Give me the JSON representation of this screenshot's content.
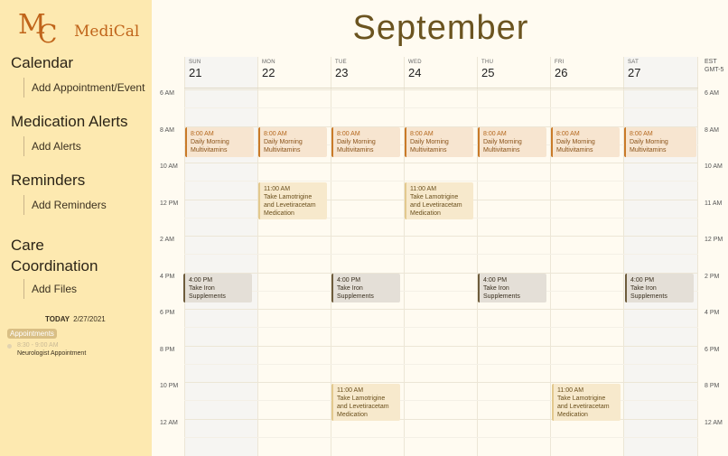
{
  "app": {
    "logo_m": "M",
    "logo_c": "C",
    "logo_text": "MediCal"
  },
  "sidebar": {
    "sections": [
      {
        "heading": "Calendar",
        "link": "Add Appointment/Event"
      },
      {
        "heading": "Medication Alerts",
        "link": "Add Alerts"
      },
      {
        "heading": "Reminders",
        "link": "Add Reminders"
      },
      {
        "heading": "Care Coordination",
        "link": "Add Files"
      }
    ],
    "today_label": "TODAY",
    "today_date": "2/27/2021",
    "appointments_chip": "Appointments",
    "appointment": {
      "time": "8:30 - 9:00 AM",
      "title": "Neurologist Appointment"
    }
  },
  "calendar": {
    "month": "September",
    "days": [
      {
        "dow": "SUN",
        "num": "21"
      },
      {
        "dow": "MON",
        "num": "22"
      },
      {
        "dow": "TUE",
        "num": "23"
      },
      {
        "dow": "WED",
        "num": "24"
      },
      {
        "dow": "THU",
        "num": "25"
      },
      {
        "dow": "FRI",
        "num": "26"
      },
      {
        "dow": "SAT",
        "num": "27"
      }
    ],
    "left_times": [
      "6 AM",
      "8 AM",
      "10 AM",
      "12 PM",
      "2 AM",
      "4 PM",
      "6 PM",
      "8 PM",
      "10 PM",
      "12 AM"
    ],
    "tz_line1": "EST",
    "tz_line2": "GMT-5",
    "right_times": [
      "6 AM",
      "8 AM",
      "10 AM",
      "11 AM",
      "12 PM",
      "2 PM",
      "4 PM",
      "6 PM",
      "8 PM",
      "12 AM"
    ],
    "events": {
      "vitamins": {
        "time": "8:00 AM",
        "title": "Daily Morning Multivitamins"
      },
      "lamotrigine": {
        "time": "11:00 AM",
        "title": "Take Lamotrigine and Levetiracetam Medication"
      },
      "iron": {
        "time": "4:00 PM",
        "title": "Take Iron Supplements"
      }
    }
  },
  "colors": {
    "sidebar_bg": "#fde9b0",
    "brand": "#c0641a",
    "vitamin_event": "#f7e5d0",
    "lamotrigine_event": "#f7e9cc",
    "iron_event": "#e4dfd7"
  }
}
